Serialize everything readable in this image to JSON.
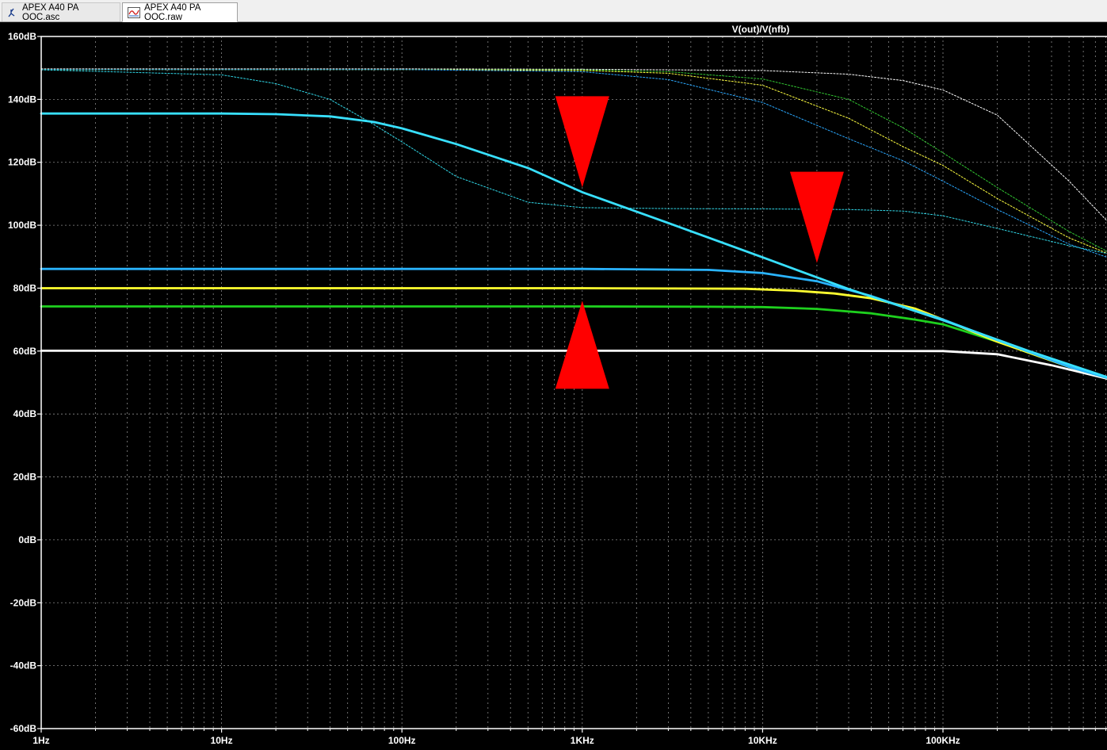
{
  "tabs": [
    {
      "label": "APEX A40 PA OOC.asc",
      "icon": "schematic-icon",
      "active": false
    },
    {
      "label": "APEX A40 PA OOC.raw",
      "icon": "waveform-icon",
      "active": true
    }
  ],
  "chart_data": {
    "type": "line",
    "title": "V(out)/V(nfb)",
    "xscale": "log",
    "xlim": [
      1,
      1000000
    ],
    "ylim": [
      -60,
      160
    ],
    "x_ticks": [
      1,
      10,
      100,
      1000,
      10000,
      100000
    ],
    "x_tick_labels": [
      "1Hz",
      "10Hz",
      "100Hz",
      "1KHz",
      "10KHz",
      "100KHz"
    ],
    "y_ticks": [
      160,
      140,
      120,
      100,
      80,
      60,
      40,
      20,
      0,
      -20,
      -40,
      -60
    ],
    "y_tick_labels": [
      "160dB",
      "140dB",
      "120dB",
      "100dB",
      "80dB",
      "60dB",
      "40dB",
      "20dB",
      "0dB",
      "-20dB",
      "-40dB",
      "-60dB"
    ],
    "grid": true,
    "colors": {
      "background": "#000000",
      "grid": "#8a8a8a",
      "frame": "#ffffff",
      "marker": "#ff0000"
    },
    "series": [
      {
        "color": "#ffffff",
        "style": "solid",
        "x": [
          1,
          1000,
          10000,
          100000,
          200000,
          400000,
          1000000
        ],
        "y": [
          60.1,
          60.1,
          60.1,
          60,
          59,
          55.5,
          50
        ]
      },
      {
        "color": "#1ed01e",
        "style": "solid",
        "x": [
          1,
          100,
          1000,
          5000,
          10000,
          20000,
          40000,
          70000,
          100000,
          200000,
          500000,
          1000000
        ],
        "y": [
          74.2,
          74.2,
          74.2,
          74.1,
          74,
          73.4,
          72,
          70,
          68.5,
          63,
          55,
          50
        ]
      },
      {
        "color": "#ffff30",
        "style": "solid",
        "x": [
          1,
          100,
          1000,
          8000,
          15000,
          25000,
          40000,
          70000,
          100000,
          200000,
          500000,
          1000000
        ],
        "y": [
          80,
          80,
          80,
          79.8,
          79.2,
          78.3,
          76.8,
          73.5,
          70,
          63,
          55,
          50
        ]
      },
      {
        "color": "#2ab4ff",
        "style": "solid",
        "x": [
          1,
          100,
          1000,
          5000,
          10000,
          20000,
          40000,
          70000,
          100000,
          200000,
          500000,
          1000000
        ],
        "y": [
          86.1,
          86.1,
          86.1,
          85.8,
          84.8,
          82.2,
          77.5,
          72.8,
          70,
          63.5,
          55,
          50
        ]
      },
      {
        "color": "#38e0ff",
        "style": "solid",
        "x": [
          1,
          10,
          20,
          40,
          70,
          100,
          200,
          500,
          1000,
          3000,
          10000,
          30000,
          100000,
          300000,
          1000000
        ],
        "y": [
          135.5,
          135.5,
          135.3,
          134.6,
          132.8,
          130.8,
          125.8,
          118.2,
          110.5,
          100.7,
          89.8,
          79.7,
          69.8,
          60,
          50
        ]
      },
      {
        "color": "#ffffff",
        "style": "dotted",
        "x": [
          1,
          100,
          1000,
          10000,
          30000,
          60000,
          100000,
          200000,
          500000,
          1000000
        ],
        "y": [
          149.7,
          149.7,
          149.6,
          149.2,
          148,
          146,
          143,
          135,
          114,
          96
        ]
      },
      {
        "color": "#32c832",
        "style": "dotted",
        "x": [
          1,
          100,
          1000,
          3000,
          10000,
          30000,
          60000,
          100000,
          200000,
          500000,
          1000000
        ],
        "y": [
          149.5,
          149.5,
          149.4,
          148.8,
          146.5,
          140,
          131,
          123,
          112,
          98,
          89
        ]
      },
      {
        "color": "#ffff40",
        "style": "dotted",
        "x": [
          1,
          100,
          1000,
          3000,
          10000,
          30000,
          60000,
          100000,
          200000,
          500000,
          1000000
        ],
        "y": [
          149.5,
          149.5,
          149.2,
          148.3,
          144.5,
          134,
          125,
          119,
          108.5,
          96,
          89
        ]
      },
      {
        "color": "#2aa8ff",
        "style": "dotted",
        "x": [
          1,
          100,
          1000,
          3000,
          10000,
          30000,
          60000,
          100000,
          200000,
          500000,
          1000000
        ],
        "y": [
          149.5,
          149.5,
          148.8,
          146.3,
          139,
          127.5,
          120.5,
          114,
          105,
          94,
          88
        ]
      },
      {
        "color": "#30d8e8",
        "style": "dotted",
        "x": [
          1,
          10,
          20,
          40,
          70,
          100,
          200,
          500,
          1000,
          3000,
          10000,
          30000,
          60000,
          100000,
          200000,
          500000,
          1000000
        ],
        "y": [
          149.4,
          147.8,
          145,
          140,
          132,
          126.5,
          115.5,
          107.3,
          105.6,
          105.3,
          105.2,
          105,
          104.5,
          103,
          99,
          93.5,
          90
        ]
      }
    ],
    "markers": [
      {
        "direction": "down",
        "x": 1000,
        "y_top": 141,
        "y_tip": 112
      },
      {
        "direction": "down",
        "x": 20000,
        "y_top": 117,
        "y_tip": 88
      },
      {
        "direction": "up",
        "x": 1000,
        "y_tip": 76,
        "y_base": 48
      }
    ]
  }
}
